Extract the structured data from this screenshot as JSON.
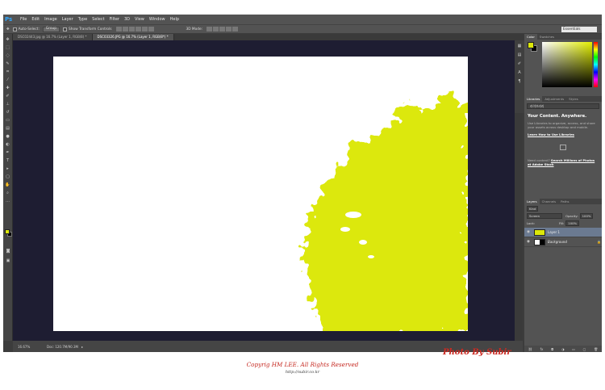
{
  "app": {
    "logo": "Ps"
  },
  "menu": [
    "File",
    "Edit",
    "Image",
    "Layer",
    "Type",
    "Select",
    "Filter",
    "3D",
    "View",
    "Window",
    "Help"
  ],
  "options": {
    "auto_select": "Auto-Select:",
    "auto_select_value": "Group",
    "show_transform": "Show Transform Controls",
    "mode_3d": "3D Mode:",
    "workspace": "Essentials"
  },
  "tabs": [
    {
      "label": "DSC02443.jpg @ 16.7% (Layer 1, RGB/8) *"
    },
    {
      "label": "DSC03326.JPG @ 16.7% (Layer 1, RGB/8*) *"
    }
  ],
  "status": {
    "zoom": "16.67%",
    "doc": "Doc: 120.7M/90.3M"
  },
  "panels": {
    "color_tabs": [
      "Color",
      "Swatches"
    ],
    "library_tabs": [
      "Libraries",
      "Adjustments",
      "Styles"
    ],
    "library_name": "라이브러리",
    "library_title": "Your Content. Anywhere.",
    "library_desc": "Use Libraries to organize, access, and share your assets across desktop and mobile.",
    "library_link": "Learn How to Use Libraries",
    "library_need": "Need content?",
    "library_search": "Search Millions of Photos at Adobe Stock",
    "layer_tabs": [
      "Layers",
      "Channels",
      "Paths"
    ],
    "kind": "Kind",
    "blend": "Screen",
    "opacity_label": "Opacity:",
    "opacity": "100%",
    "lock_label": "Lock:",
    "fill_label": "Fill:",
    "fill": "100%",
    "layers": [
      {
        "name": "Layer 1"
      },
      {
        "name": "Background"
      }
    ]
  },
  "watermark": {
    "photo_by": "Photo By Subir",
    "copyright": "Copyrig HM LEE. All Rights Reserved",
    "url": "http://subir.co.kr"
  },
  "colors": {
    "splash": "#dce80a",
    "canvas_bg": "#1e1d32",
    "ui": "#535353"
  }
}
